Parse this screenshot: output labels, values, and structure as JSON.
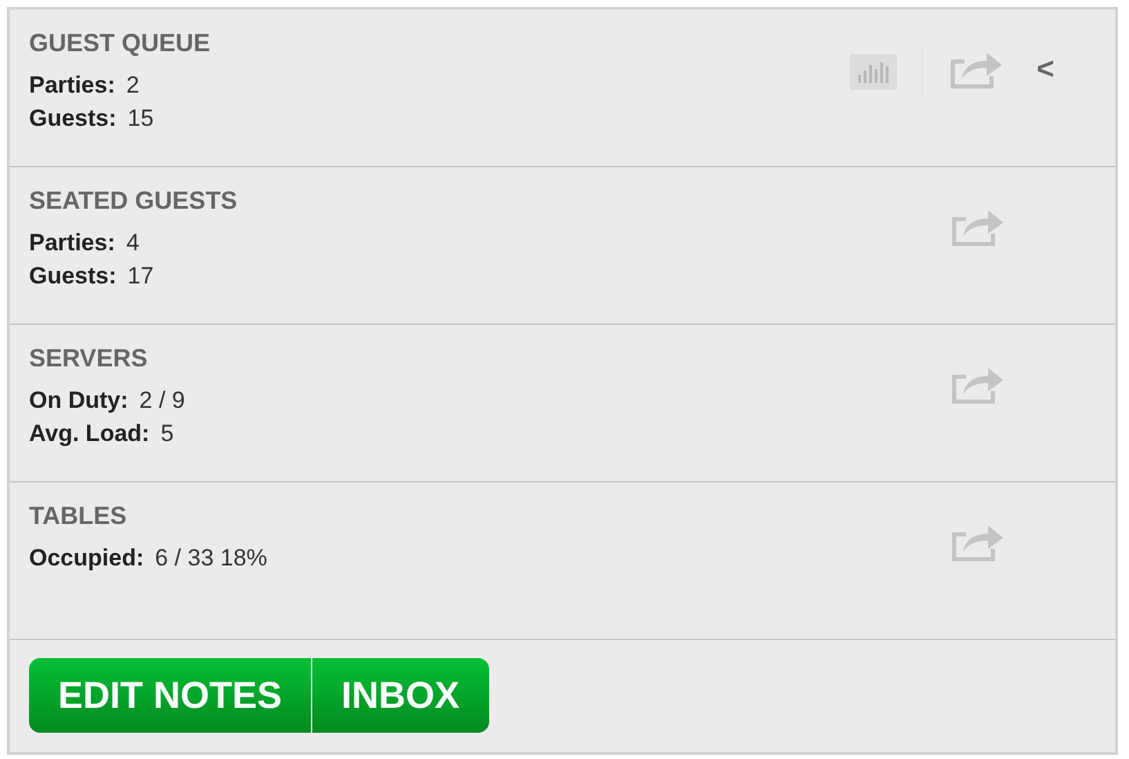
{
  "sections": [
    {
      "title": "GUEST QUEUE",
      "stats": [
        {
          "label": "Parties:",
          "value": "2"
        },
        {
          "label": "Guests:",
          "value": "15"
        }
      ],
      "tools": [
        {
          "kind": "chart"
        },
        {
          "kind": "share"
        },
        {
          "kind": "collapse",
          "label": "<"
        }
      ]
    },
    {
      "title": "SEATED GUESTS",
      "stats": [
        {
          "label": "Parties:",
          "value": "4"
        },
        {
          "label": "Guests:",
          "value": "17"
        }
      ],
      "tools": [
        {
          "kind": "share"
        }
      ]
    },
    {
      "title": "SERVERS",
      "stats": [
        {
          "label": "On Duty:",
          "value": "2 / 9"
        },
        {
          "label": "Avg. Load:",
          "value": "5"
        }
      ],
      "tools": [
        {
          "kind": "share"
        }
      ]
    },
    {
      "title": "TABLES",
      "stats": [
        {
          "label": "Occupied:",
          "value": "6 / 33 18%"
        }
      ],
      "tools": [
        {
          "kind": "share"
        }
      ]
    }
  ],
  "buttons": [
    "EDIT NOTES",
    "INBOX"
  ]
}
